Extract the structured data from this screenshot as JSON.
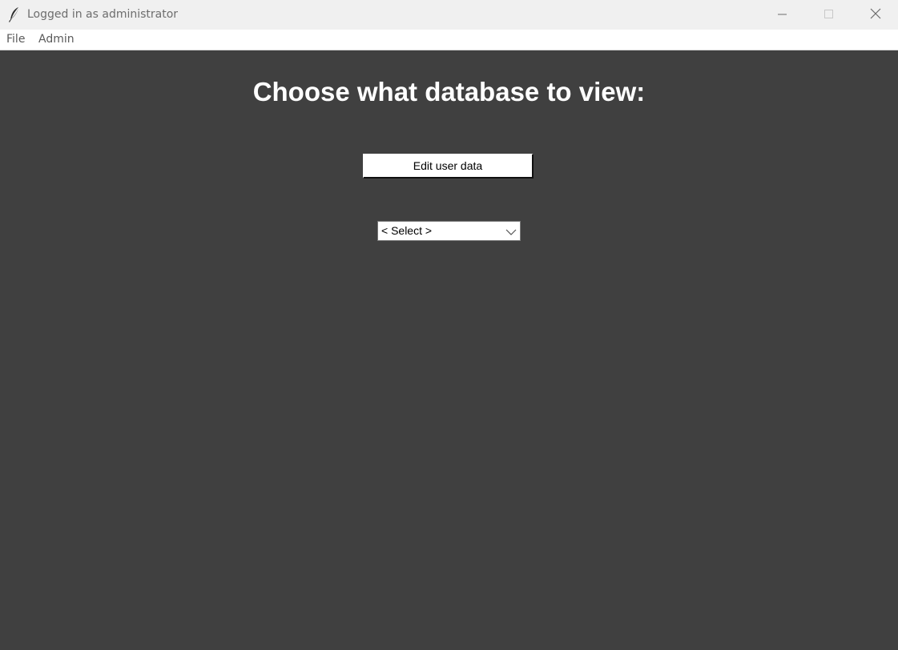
{
  "window": {
    "title": "Logged in as administrator",
    "app_icon": "feather-icon",
    "controls": {
      "minimize_icon": "minimize-icon",
      "maximize_icon": "maximize-icon",
      "close_icon": "close-icon"
    }
  },
  "menubar": {
    "items": [
      {
        "label": "File"
      },
      {
        "label": "Admin"
      }
    ]
  },
  "main": {
    "heading": "Choose what database to view:",
    "edit_button_label": "Edit user data",
    "select": {
      "value": "< Select >",
      "arrow_icon": "chevron-down-icon"
    }
  },
  "colors": {
    "background": "#404040",
    "titlebar": "#f0f0f0",
    "menubar": "#ffffff",
    "heading_text": "#ffffff"
  }
}
